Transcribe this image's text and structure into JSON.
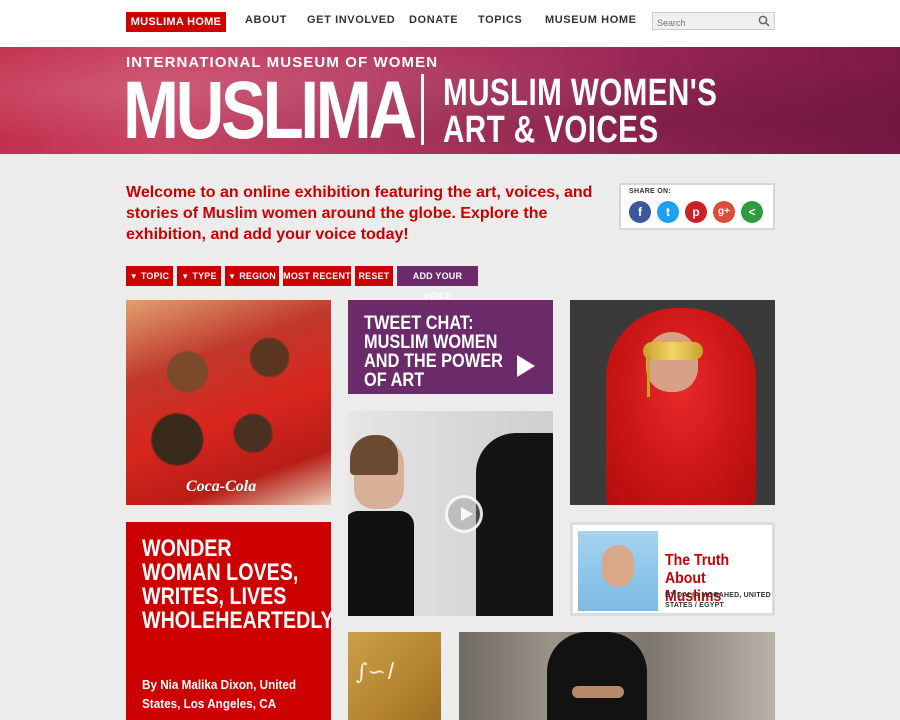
{
  "nav": {
    "home_label": "MUSLIMA HOME",
    "links": [
      "ABOUT",
      "GET INVOLVED",
      "DONATE",
      "TOPICS",
      "MUSEUM HOME"
    ],
    "search_placeholder": "Search"
  },
  "banner": {
    "subtitle": "INTERNATIONAL MUSEUM OF WOMEN",
    "title": "MUSLIMA",
    "tagline_line1": "MUSLIM WOMEN'S",
    "tagline_line2": "ART & VOICES"
  },
  "intro": {
    "text": "Welcome to an online exhibition featuring the art, voices, and stories of Muslim women around the globe. Explore the exhibition, and add your voice today!"
  },
  "share": {
    "label": "SHARE ON:",
    "networks": [
      {
        "name": "facebook-icon",
        "glyph": "f",
        "color": "#3b5998"
      },
      {
        "name": "twitter-icon",
        "glyph": "t",
        "color": "#1da1f2"
      },
      {
        "name": "pinterest-icon",
        "glyph": "p",
        "color": "#cb2027"
      },
      {
        "name": "googleplus-icon",
        "glyph": "g+",
        "color": "#dd4b39"
      },
      {
        "name": "sharethis-icon",
        "glyph": "<",
        "color": "#2e9b3f"
      }
    ]
  },
  "filters": {
    "topic": "TOPIC",
    "type": "TYPE",
    "region": "REGION",
    "most_recent": "MOST RECENT",
    "reset": "RESET",
    "add_voice": "ADD YOUR VOICE"
  },
  "tiles": {
    "tweet_chat": "TWEET CHAT: MUSLIM WOMEN AND THE POWER OF ART",
    "truth_title": "The Truth About Muslims",
    "truth_byline": "BY DALIA MOGAHED, UNITED STATES / EGYPT",
    "wonder_quote": "WONDER WOMAN LOVES, WRITES, LIVES WHOLEHEARTEDLY.",
    "wonder_byline": "By Nia Malika Dixon, United States, Los Angeles, CA",
    "team_logo": "Coca-Cola"
  },
  "colors": {
    "accent_red": "#cc0000",
    "accent_purple": "#6b2b6b"
  }
}
